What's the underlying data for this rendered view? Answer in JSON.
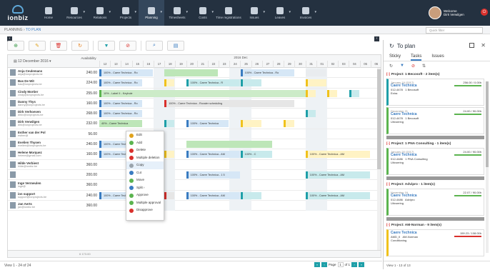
{
  "app": {
    "logo": "ionbiz",
    "welcome": "Welcome",
    "user": "Dirk Verwilgen"
  },
  "nav": [
    "Home",
    "Resources",
    "Relations",
    "Projects",
    "Planning",
    "Timesheets",
    "Costs",
    "Time registrations",
    "Issues",
    "Leaves",
    "Invoices"
  ],
  "breadcrumb": {
    "root": "PLANNING",
    "current": "TO PLAN"
  },
  "quick_filter": "Quick filter",
  "toolbar_icons": [
    "add-icon",
    "edit-icon",
    "delete-icon",
    "refresh-icon",
    "filter-icon",
    "clear-filter-icon",
    "zoom-icon",
    "view-toggle-icon"
  ],
  "grid": {
    "date": "12 December 2016",
    "availability_header": "Availability",
    "month": "2016 Dec",
    "days": [
      "12",
      "13",
      "14",
      "15",
      "16",
      "17",
      "18",
      "19",
      "20",
      "21",
      "22",
      "23",
      "24",
      "25",
      "26",
      "27",
      "28",
      "29",
      "30",
      "31",
      "01",
      "02",
      "03",
      "04",
      "05",
      "06"
    ],
    "rows": [
      {
        "name": "Anja Ceulemans",
        "email": "anja@ionprojects.be",
        "avail": "240.00"
      },
      {
        "name": "Bas De Wit",
        "email": "bas@ionprojects.be",
        "avail": "224.00"
      },
      {
        "name": "Cindy Mortier",
        "email": "cindy@ionprojects.be",
        "avail": "255.00"
      },
      {
        "name": "Danny Thys",
        "email": "danny@ionprojects.be",
        "avail": "160.00"
      },
      {
        "name": "Dirk Verhoeven",
        "email": "dirkv@ionprojects.be",
        "avail": "268.00"
      },
      {
        "name": "Dirk Verwilgen",
        "email": "dirk@ionprojects.be",
        "avail": "232.00"
      },
      {
        "name": "Esther van der Pol",
        "email": "esther@",
        "avail": "56.00"
      },
      {
        "name": "Evelien Thysen",
        "email": "evelien@ionprojects.be",
        "avail": "240.00"
      },
      {
        "name": "Helene Morquez",
        "email": "helene@gmail.com",
        "avail": "160.00"
      },
      {
        "name": "Hilde Verbiest",
        "email": "hilde@ionbiz.be",
        "avail": "360.00"
      },
      {
        "name": "",
        "email": "",
        "avail": "200.00"
      },
      {
        "name": "Inge Vermeulen",
        "email": "inge@",
        "avail": "360.00"
      },
      {
        "name": "ion support",
        "email": "support@ionprojects.be",
        "avail": "240.00"
      },
      {
        "name": "Jan Aerts",
        "email": "jan@ionbiz.be",
        "avail": "360.00"
      }
    ],
    "total": "6 173.00"
  },
  "bars": {
    "b1": "100% - Caere Technica - Ro",
    "b2": "100% - Caere Technica - Ro",
    "b3": "100% - Caere Technica - Ro",
    "b4": "100% - Caere Technica - R",
    "b5": "10% - Label II - Keyhole",
    "b6": "100% - Caere Technica - Ro",
    "b7": "100% - Caere Technica - Rovaler scheduling",
    "b8": "100% - Caere Technica - Ro",
    "b9": "40% - Caere Technica",
    "b10": "100% - Caere Technica",
    "b11": "100% - Caere Technica - AM",
    "b12": "100% - Caere Technica - Ro",
    "b13": "100% - Caere Technica - AM",
    "b14": "100% - C",
    "b15": "100% - Caere Technica - 1 5",
    "b16": "100% - Caere Technica - AM",
    "b17": "100% - Caere Technica - Ro",
    "b18": "100% - Caere Technica - AM",
    "b19": "100% - Caere Technica - AM"
  },
  "context_menu": [
    "Edit",
    "Add",
    "Delete",
    "Multiple deletion",
    "Copy",
    "Cut",
    "Move",
    "Split",
    "Approve",
    "Multiple approval",
    "Disapprove"
  ],
  "footer": {
    "view": "View 1 - 24 of 24",
    "page": "Page",
    "of": "of 1"
  },
  "side": {
    "title": "To plan",
    "tabs": [
      "Sticky",
      "Tasks",
      "Issues"
    ],
    "projects": [
      {
        "title": "Project: 1 Becosoft - 2 item(s)",
        "cards": [
          {
            "date": "January 16 (2017)",
            "hours": "256.00 / 0.00h",
            "title": "Caere Technica",
            "code": "012-4478",
            "client": "1 Becosoft",
            "note": "Extra"
          },
          {
            "date": "December 21",
            "hours": "24.00 / 90.00h",
            "title": "Caere Technica",
            "code": "012-4478",
            "client": "1 Becosoft",
            "note": "Uitvoering"
          }
        ]
      },
      {
        "title": "Project: 1 PNA Consulting - 1 item(s)",
        "cards": [
          {
            "date": "January 20 (2017)",
            "hours": "24.00 / 90.00h",
            "title": "Caere Technica",
            "code": "012-4486",
            "client": "1 PNA Consulting",
            "note": "Uitvoering"
          }
        ]
      },
      {
        "title": "Project: Advipro - 1 item(s)",
        "cards": [
          {
            "date": "November 16",
            "hours": "22.07 / 90.00h",
            "title": "Caere Technica",
            "code": "012-4486",
            "client": "Advipro",
            "note": "Uitvoering"
          }
        ]
      },
      {
        "title": "Project: AM-Norman - 9 item(s)",
        "cards": [
          {
            "date": "",
            "hours": "159.23 / 108.00h",
            "title": "Caere Technica",
            "code": "AMD_II",
            "client": "AM-Norman",
            "note": "Conditioning"
          }
        ]
      }
    ],
    "footer": "View 1 - 13 of 13"
  },
  "colors": {
    "topbar": "#243140",
    "accent": "#3a7cc1",
    "green": "#5bb44f",
    "teal": "#1e9fa8",
    "red": "#d9302c"
  }
}
